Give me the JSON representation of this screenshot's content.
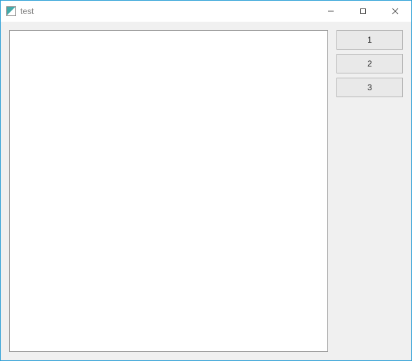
{
  "window": {
    "title": "test"
  },
  "side": {
    "buttons": [
      {
        "label": "1"
      },
      {
        "label": "2"
      },
      {
        "label": "3"
      }
    ]
  }
}
